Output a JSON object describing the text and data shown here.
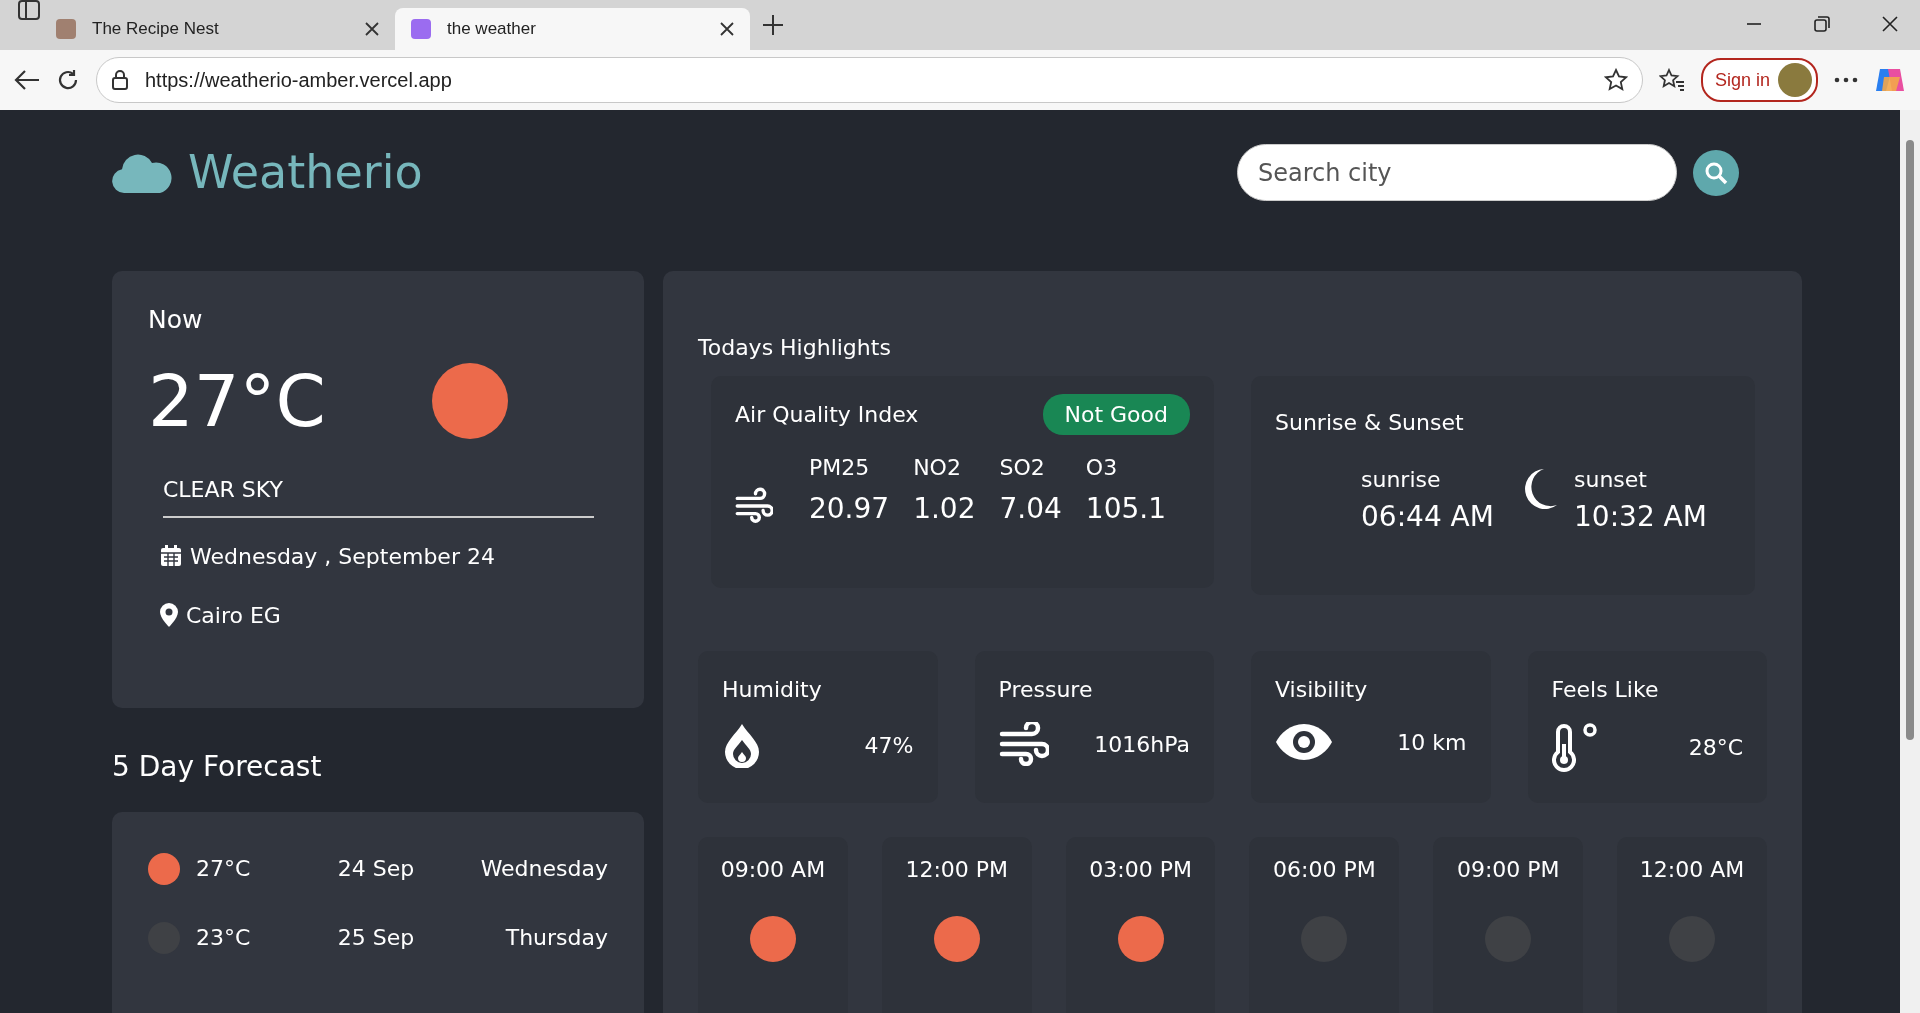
{
  "browser": {
    "tabs": [
      {
        "title": "The Recipe Nest",
        "selected": false
      },
      {
        "title": "the weather",
        "selected": true
      }
    ],
    "url": "https://weatherio-amber.vercel.app",
    "sign_in": "Sign in"
  },
  "header": {
    "logo": "Weatherio",
    "search": {
      "placeholder": "Search city"
    }
  },
  "now": {
    "heading": "Now",
    "temperature": "27°C",
    "kind": "sun",
    "description": "CLEAR SKY",
    "date": "Wednesday , September 24",
    "location": "Cairo EG"
  },
  "forecast": {
    "heading": "5 Day Forecast",
    "days": [
      {
        "kind": "sun",
        "temperature": "27°C",
        "date": "24 Sep",
        "weekday": "Wednesday"
      },
      {
        "kind": "night",
        "temperature": "23°C",
        "date": "25 Sep",
        "weekday": "Thursday"
      }
    ]
  },
  "highlights": {
    "heading": "Todays Highlights",
    "air_quality": {
      "title": "Air Quality Index",
      "badge": "Not Good",
      "readings": [
        {
          "label": "PM25",
          "value": "20.97"
        },
        {
          "label": "NO2",
          "value": "1.02"
        },
        {
          "label": "SO2",
          "value": "7.04"
        },
        {
          "label": "O3",
          "value": "105.1"
        }
      ]
    },
    "sun": {
      "title": "Sunrise & Sunset",
      "times": [
        {
          "kind": "sunrise",
          "label": "sunrise",
          "time": "06:44 AM"
        },
        {
          "kind": "sunset",
          "label": "sunset",
          "time": "10:32 AM"
        }
      ]
    },
    "stats": [
      {
        "kind": "humidity",
        "label": "Humidity",
        "value": "47%"
      },
      {
        "kind": "pressure",
        "label": "Pressure",
        "value": "1016hPa"
      },
      {
        "kind": "visibility",
        "label": "Visibility",
        "value": "10 km"
      },
      {
        "kind": "feels",
        "label": "Feels Like",
        "value": "28°C"
      }
    ],
    "hourly": [
      {
        "time": "09:00 AM",
        "kind": "sun"
      },
      {
        "time": "12:00 PM",
        "kind": "sun"
      },
      {
        "time": "03:00 PM",
        "kind": "sun"
      },
      {
        "time": "06:00 PM",
        "kind": "night"
      },
      {
        "time": "09:00 PM",
        "kind": "night"
      },
      {
        "time": "12:00 AM",
        "kind": "night"
      }
    ]
  }
}
